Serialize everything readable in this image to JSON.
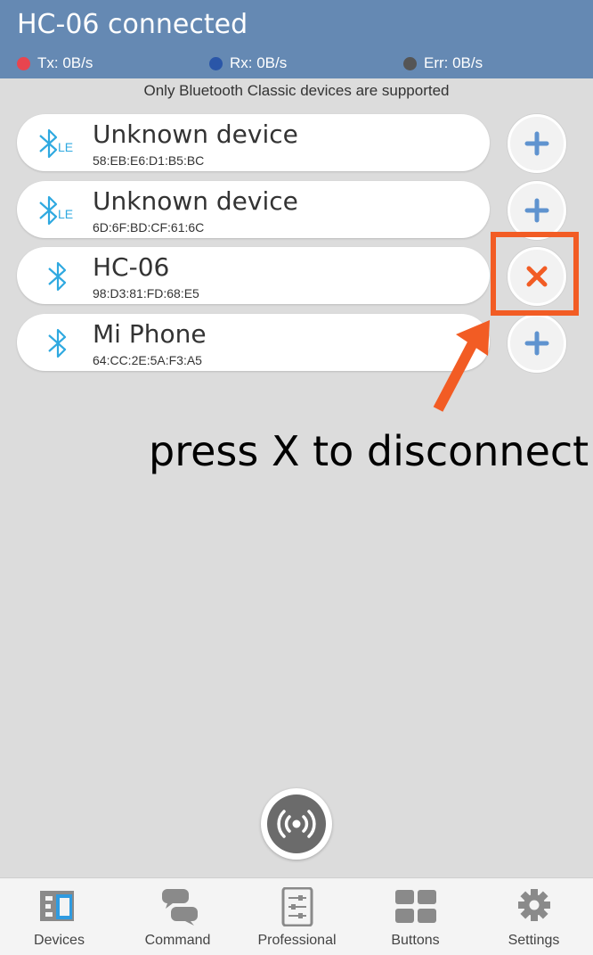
{
  "header": {
    "title": "HC-06 connected",
    "tx": "Tx: 0B/s",
    "rx": "Rx: 0B/s",
    "err": "Err: 0B/s",
    "colors": {
      "bg": "#6589b3",
      "tx_dot": "#e8454f",
      "rx_dot": "#2a56a8",
      "err_dot": "#555555"
    }
  },
  "notice": "Only Bluetooth Classic devices are supported",
  "devices": [
    {
      "name": "Unknown device",
      "mac": "58:EB:E6:D1:B5:BC",
      "type": "LE",
      "icon": "bluetooth-le-icon",
      "action": "connect",
      "action_icon": "plus-icon"
    },
    {
      "name": "Unknown device",
      "mac": "6D:6F:BD:CF:61:6C",
      "type": "LE",
      "icon": "bluetooth-le-icon",
      "action": "connect",
      "action_icon": "plus-icon"
    },
    {
      "name": "HC-06",
      "mac": "98:D3:81:FD:68:E5",
      "type": "Classic",
      "icon": "bluetooth-icon",
      "action": "disconnect",
      "action_icon": "close-icon"
    },
    {
      "name": "Mi Phone",
      "mac": "64:CC:2E:5A:F3:A5",
      "type": "Classic",
      "icon": "bluetooth-icon",
      "action": "connect",
      "action_icon": "plus-icon"
    }
  ],
  "annotation": {
    "text": "press X to disconnect",
    "color": "#f25c24"
  },
  "scan_button": {
    "icon": "broadcast-icon"
  },
  "tabs": [
    {
      "label": "Devices",
      "icon": "devices-icon",
      "active": true
    },
    {
      "label": "Command",
      "icon": "chat-icon",
      "active": false
    },
    {
      "label": "Professional",
      "icon": "sliders-icon",
      "active": false
    },
    {
      "label": "Buttons",
      "icon": "grid-icon",
      "active": false
    },
    {
      "label": "Settings",
      "icon": "gear-icon",
      "active": false
    }
  ]
}
